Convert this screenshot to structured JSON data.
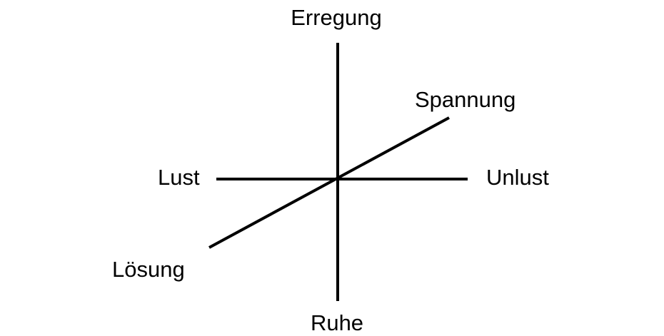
{
  "diagram": {
    "labels": {
      "top": "Erregung",
      "bottom": "Ruhe",
      "left": "Lust",
      "right": "Unlust",
      "diag_upper": "Spannung",
      "diag_lower": "Lösung"
    },
    "colors": {
      "line": "#000000",
      "text": "#000000",
      "background": "#ffffff"
    }
  }
}
